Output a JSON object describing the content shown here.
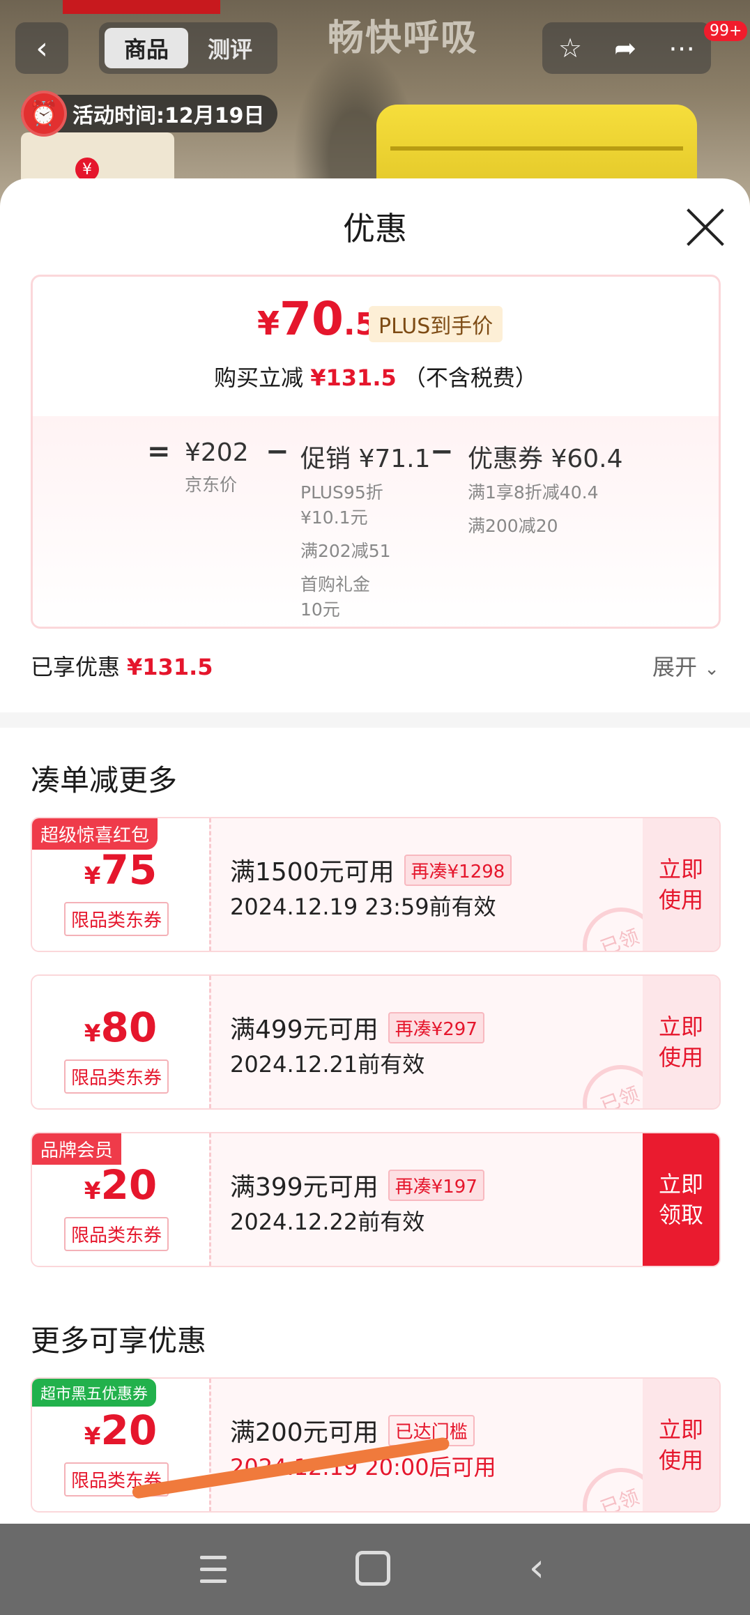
{
  "header": {
    "slogan": "畅快呼吸",
    "tabs": [
      "商品",
      "测评"
    ],
    "message_badge": "99+",
    "activity_time": "活动时间:12月19日",
    "small_yen": "¥"
  },
  "sheet": {
    "title": "优惠",
    "final_price": {
      "yen": "¥",
      "int": "70",
      "dec": ".5"
    },
    "plus_tag": "PLUS到手价",
    "reduce_prefix": "购买立减",
    "reduce_amount": "¥131.5",
    "reduce_suffix": "（不含税费）",
    "calc": {
      "eq": "=",
      "base": {
        "main": "¥202",
        "sub": "京东价"
      },
      "minus1": "−",
      "promo": {
        "main": "促销 ¥71.1",
        "subs": [
          "PLUS95折",
          "¥10.1元",
          "满202减51",
          "首购礼金",
          "10元"
        ]
      },
      "minus2": "−",
      "coupon": {
        "main": "优惠券 ¥60.4",
        "subs": [
          "满1享8折减40.4",
          "满200减20"
        ]
      }
    },
    "enjoyed_label": "已享优惠",
    "enjoyed_amount": "¥131.5",
    "expand_label": "展开",
    "section1_title": "凑单减更多",
    "section2_title": "更多可享优惠"
  },
  "coupons": [
    {
      "tag": "超级惊喜红包",
      "tag_color": "#ef3b4a",
      "yen": "¥",
      "amount": "75",
      "category": "限品类东券",
      "condition": "满1500元可用",
      "extra": "再凑¥1298",
      "date": "2024.12.19 23:59前有效",
      "action": "立即使用",
      "stamp": "已领"
    },
    {
      "tag": "",
      "yen": "¥",
      "amount": "80",
      "category": "限品类东券",
      "condition": "满499元可用",
      "extra": "再凑¥297",
      "date": "2024.12.21前有效",
      "action": "立即使用",
      "stamp": "已领"
    },
    {
      "tag": "品牌会员",
      "tag_color": "#ef3b4a",
      "yen": "¥",
      "amount": "20",
      "category": "限品类东券",
      "condition": "满399元可用",
      "extra": "再凑¥197",
      "date": "2024.12.22前有效",
      "action": "立即领取"
    },
    {
      "tag": "超市黑五优惠券",
      "tag_color": "#22b14c",
      "yen": "¥",
      "amount": "20",
      "category": "限品类东券",
      "condition": "满200元可用",
      "extra": "已达门槛",
      "date": "2024.12.19 20:00后可用",
      "action": "立即使用",
      "stamp": "已领"
    }
  ],
  "colors": {
    "brand_red": "#e5162c",
    "plus_gold": "#7d4b14"
  },
  "icons": [
    "back-icon",
    "star-icon",
    "share-icon",
    "more-icon",
    "alarm-clock-icon",
    "close-icon",
    "chevron-down-icon",
    "menu-icon",
    "home-icon",
    "nav-back-icon"
  ]
}
